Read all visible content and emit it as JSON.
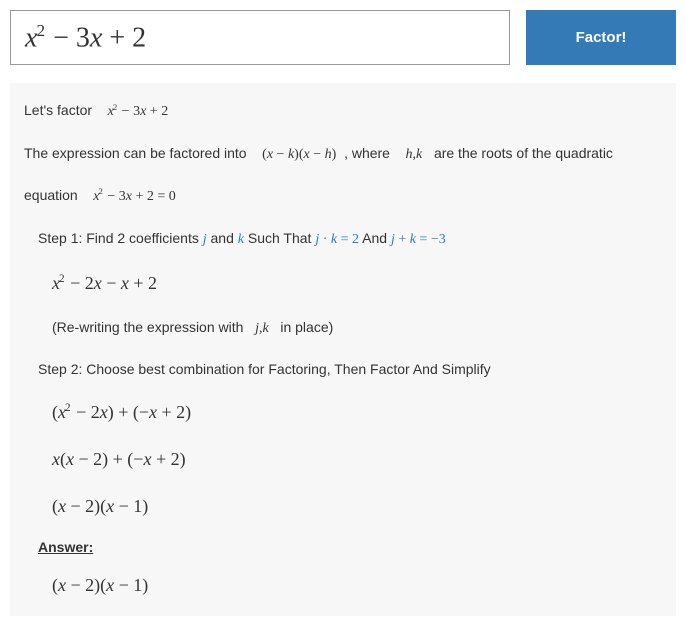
{
  "input": {
    "expression_html": "x<span class='sup'>2</span> <span class='upr'>−</span> <span class='upr'>3</span>x <span class='upr'>+</span> <span class='upr'>2</span>"
  },
  "button": {
    "label": "Factor!"
  },
  "intro": {
    "lets_factor": "Let's factor",
    "expr_html": "x<span class='sup'>2</span> <span class='upr'>− 3</span>x <span class='upr'>+ 2</span>",
    "sentence_a": "The expression can be factored into",
    "form_html": "<span class='upr'>(</span>x <span class='upr'>−</span> k<span class='upr'>)(</span>x <span class='upr'>−</span> h<span class='upr'>)</span>",
    "where": ", where",
    "hk_html": "h<span class='upr'>,</span>k",
    "sentence_b": "are the roots of the quadratic",
    "equation_word": "equation",
    "eqn_html": "x<span class='sup'>2</span> <span class='upr'>− 3</span>x <span class='upr'>+ 2 = 0</span>"
  },
  "step1": {
    "title_a": "Step 1: Find 2 coefficients ",
    "j_html": "j",
    "and": " and ",
    "k_html": "k",
    "such": " Such That ",
    "cond1_html": "j <span class='upr'>·</span> k <span class='upr'>= 2</span>",
    "and2": " And ",
    "cond2_html": "j <span class='upr'>+</span> k <span class='upr'>= −3</span>",
    "rewrite_html": "x<span class='sup'>2</span> <span class='upr'>− 2</span>x <span class='upr'>−</span> x <span class='upr'>+ 2</span>",
    "note_a": "(Re-writing the expression with",
    "jk_html": "j<span class='upr'>,</span>k",
    "note_b": "in place)"
  },
  "step2": {
    "title": "Step 2: Choose best combination for Factoring, Then Factor And Simplify",
    "l1_html": "<span class='upr'>(</span>x<span class='sup'>2</span> <span class='upr'>− 2</span>x<span class='upr'>) + (−</span>x <span class='upr'>+ 2)</span>",
    "l2_html": "x<span class='upr'>(</span>x <span class='upr'>− 2) + (−</span>x <span class='upr'>+ 2)</span>",
    "l3_html": "<span class='upr'>(</span>x <span class='upr'>− 2)(</span>x <span class='upr'>− 1)</span>"
  },
  "answer": {
    "label": "Answer:",
    "expr_html": "<span class='upr'>(</span>x <span class='upr'>− 2)(</span>x <span class='upr'>− 1)</span>"
  }
}
